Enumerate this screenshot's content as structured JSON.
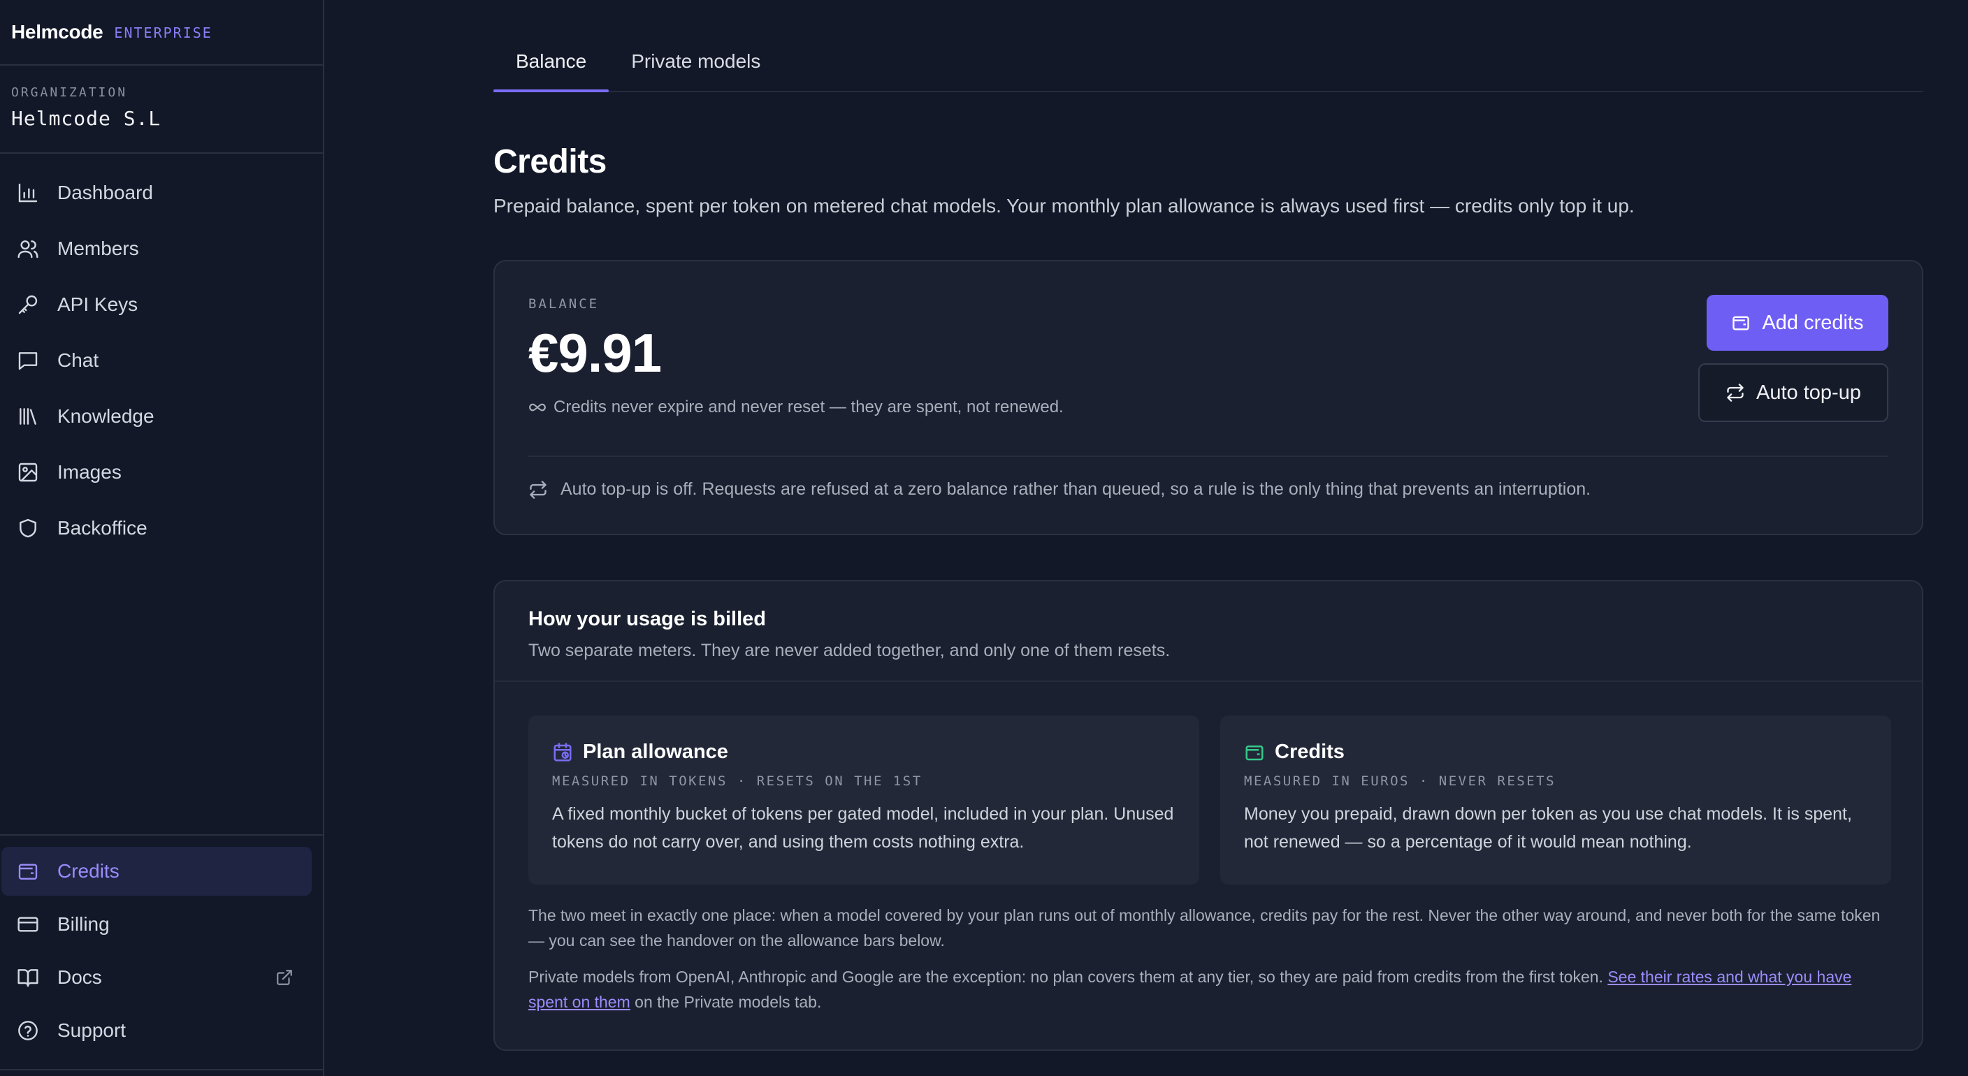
{
  "brand": {
    "name": "Helmcode",
    "tag": "ENTERPRISE"
  },
  "organization": {
    "label": "ORGANIZATION",
    "name": "Helmcode S.L"
  },
  "nav": {
    "items": [
      {
        "label": "Dashboard",
        "icon": "bar-chart-icon"
      },
      {
        "label": "Members",
        "icon": "users-icon"
      },
      {
        "label": "API Keys",
        "icon": "key-icon"
      },
      {
        "label": "Chat",
        "icon": "message-square-icon"
      },
      {
        "label": "Knowledge",
        "icon": "library-icon"
      },
      {
        "label": "Images",
        "icon": "image-icon"
      },
      {
        "label": "Backoffice",
        "icon": "shield-icon"
      }
    ],
    "bottom": [
      {
        "label": "Credits",
        "icon": "wallet-icon",
        "active": true
      },
      {
        "label": "Billing",
        "icon": "credit-card-icon"
      },
      {
        "label": "Docs",
        "icon": "book-open-icon"
      },
      {
        "label": "Support",
        "icon": "help-circle-icon"
      }
    ]
  },
  "tabs": [
    {
      "label": "Balance",
      "active": true
    },
    {
      "label": "Private models",
      "active": false
    }
  ],
  "page": {
    "title": "Credits",
    "subtitle": "Prepaid balance, spent per token on metered chat models. Your monthly plan allowance is always used first — credits only top it up."
  },
  "balance": {
    "label": "BALANCE",
    "amount": "€9.91",
    "note": "Credits never expire and never reset — they are spent, not renewed.",
    "auto_status": "Auto top-up is off. Requests are refused at a zero balance rather than queued, so a rule is the only thing that prevents an interruption.",
    "add_label": "Add credits",
    "auto_label": "Auto top-up"
  },
  "billing": {
    "title": "How your usage is billed",
    "subtitle": "Two separate meters. They are never added together, and only one of them resets.",
    "meters": [
      {
        "title": "Plan allowance",
        "sub": "MEASURED IN TOKENS · RESETS ON THE 1ST",
        "text": "A fixed monthly bucket of tokens per gated model, included in your plan. Unused tokens do not carry over, and using them costs nothing extra."
      },
      {
        "title": "Credits",
        "sub": "MEASURED IN EUROS · NEVER RESETS",
        "text": "Money you prepaid, drawn down per token as you use chat models. It is spent, not renewed — so a percentage of it would mean nothing."
      }
    ],
    "foot1": "The two meet in exactly one place: when a model covered by your plan runs out of monthly allowance, credits pay for the rest. Never the other way around, and never both for the same token — you can see the handover on the allowance bars below.",
    "foot2_pre": "Private models from OpenAI, Anthropic and Google are the exception: no plan covers them at any tier, so they are paid from credits from the first token. ",
    "foot2_link": "See their rates and what you have spent on them",
    "foot2_post": " on the Private models tab."
  },
  "colors": {
    "accent": "#6f5ef3",
    "accent_text": "#9b8cfb",
    "plan_icon": "#7a6cf4",
    "credits_icon": "#34c98a",
    "background": "#131828",
    "card": "#1b2030"
  }
}
